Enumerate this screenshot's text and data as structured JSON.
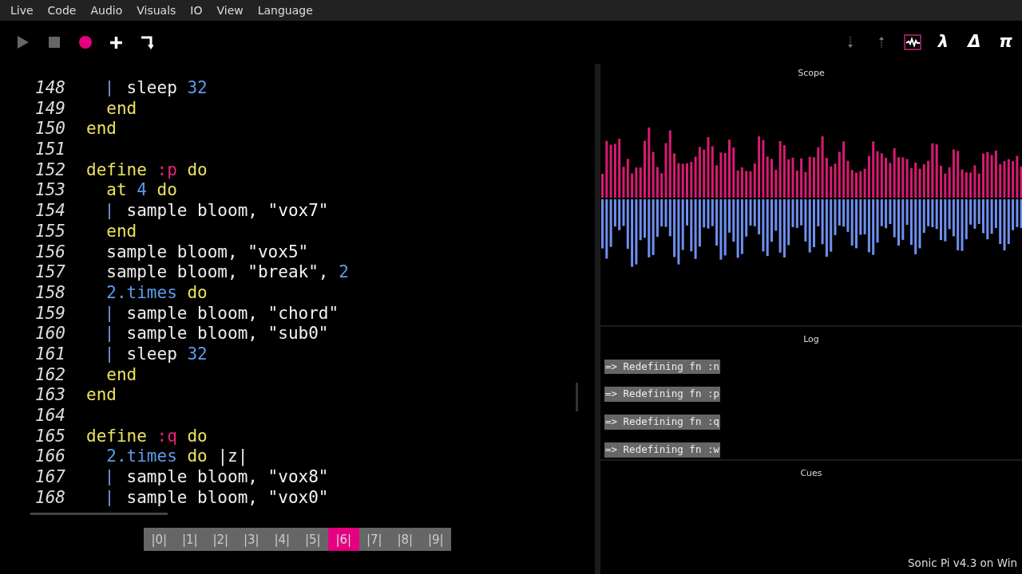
{
  "menu": [
    "Live",
    "Code",
    "Audio",
    "Visuals",
    "IO",
    "View",
    "Language"
  ],
  "toolbar": {
    "record_on": true,
    "scope_selected": true,
    "glyph_buttons": [
      "λ",
      "Δ",
      "π"
    ]
  },
  "editor": {
    "lines": [
      {
        "number": "148",
        "guide": true,
        "tokens": [
          {
            "kind": "plain",
            "text": "    sleep "
          },
          {
            "kind": "number",
            "text": "32"
          }
        ]
      },
      {
        "number": "149",
        "guide": false,
        "tokens": [
          {
            "kind": "keyword",
            "text": "  end"
          }
        ]
      },
      {
        "number": "150",
        "guide": false,
        "tokens": [
          {
            "kind": "keyword",
            "text": "end"
          }
        ]
      },
      {
        "number": "151",
        "guide": false
      },
      {
        "number": "152",
        "guide": false,
        "tokens": [
          {
            "kind": "keyword",
            "text": "define "
          },
          {
            "kind": "symbol",
            "text": ":p"
          },
          {
            "kind": "keyword",
            "text": " do"
          }
        ]
      },
      {
        "number": "153",
        "guide": false,
        "tokens": [
          {
            "kind": "keyword",
            "text": "  at "
          },
          {
            "kind": "number",
            "text": "4"
          },
          {
            "kind": "keyword",
            "text": " do"
          }
        ]
      },
      {
        "number": "154",
        "guide": true,
        "tokens": [
          {
            "kind": "plain",
            "text": "    sample bloom, "
          },
          {
            "kind": "string",
            "text": "\"vox7\""
          }
        ]
      },
      {
        "number": "155",
        "guide": false,
        "tokens": [
          {
            "kind": "keyword",
            "text": "  end"
          }
        ]
      },
      {
        "number": "156",
        "guide": false,
        "tokens": [
          {
            "kind": "plain",
            "text": "  sample bloom, "
          },
          {
            "kind": "string",
            "text": "\"vox5\""
          }
        ]
      },
      {
        "number": "157",
        "guide": false,
        "tokens": [
          {
            "kind": "plain",
            "text": "  sample bloom, "
          },
          {
            "kind": "string",
            "text": "\"break\""
          },
          {
            "kind": "plain",
            "text": ", "
          },
          {
            "kind": "number",
            "text": "2"
          }
        ]
      },
      {
        "number": "158",
        "guide": false,
        "tokens": [
          {
            "kind": "number",
            "text": "  2.times"
          },
          {
            "kind": "keyword",
            "text": " do"
          }
        ]
      },
      {
        "number": "159",
        "guide": true,
        "tokens": [
          {
            "kind": "plain",
            "text": "    sample bloom, "
          },
          {
            "kind": "string",
            "text": "\"chord\""
          }
        ]
      },
      {
        "number": "160",
        "guide": true,
        "tokens": [
          {
            "kind": "plain",
            "text": "    sample bloom, "
          },
          {
            "kind": "string",
            "text": "\"sub0\""
          }
        ]
      },
      {
        "number": "161",
        "guide": true,
        "tokens": [
          {
            "kind": "plain",
            "text": "    sleep "
          },
          {
            "kind": "number",
            "text": "32"
          }
        ]
      },
      {
        "number": "162",
        "guide": false,
        "tokens": [
          {
            "kind": "keyword",
            "text": "  end"
          }
        ]
      },
      {
        "number": "163",
        "guide": false,
        "tokens": [
          {
            "kind": "keyword",
            "text": "end"
          }
        ]
      },
      {
        "number": "164",
        "guide": false
      },
      {
        "number": "165",
        "guide": false,
        "tokens": [
          {
            "kind": "keyword",
            "text": "define "
          },
          {
            "kind": "symbol",
            "text": ":q"
          },
          {
            "kind": "keyword",
            "text": " do"
          }
        ]
      },
      {
        "number": "166",
        "guide": false,
        "tokens": [
          {
            "kind": "number",
            "text": "  2.times"
          },
          {
            "kind": "keyword",
            "text": " do "
          },
          {
            "kind": "plain",
            "text": "|z|"
          }
        ]
      },
      {
        "number": "167",
        "guide": true,
        "tokens": [
          {
            "kind": "plain",
            "text": "    sample bloom, "
          },
          {
            "kind": "string",
            "text": "\"vox8\""
          }
        ]
      },
      {
        "number": "168",
        "guide": true,
        "tokens": [
          {
            "kind": "plain",
            "text": "    sample bloom, "
          },
          {
            "kind": "string",
            "text": "\"vox0\""
          }
        ]
      }
    ]
  },
  "buffers": [
    {
      "label": "|0|",
      "selected": false
    },
    {
      "label": "|1|",
      "selected": false
    },
    {
      "label": "|2|",
      "selected": false
    },
    {
      "label": "|3|",
      "selected": false
    },
    {
      "label": "|4|",
      "selected": false
    },
    {
      "label": "|5|",
      "selected": false
    },
    {
      "label": "|6|",
      "selected": true
    },
    {
      "label": "|7|",
      "selected": false
    },
    {
      "label": "|8|",
      "selected": false
    },
    {
      "label": "|9|",
      "selected": false
    }
  ],
  "scope": {
    "title": "Scope"
  },
  "log": {
    "title": "Log",
    "entries": [
      "=> Redefining fn :n",
      "=> Redefining fn :p",
      "=> Redefining fn :q",
      "=> Redefining fn :w"
    ]
  },
  "cues": {
    "title": "Cues"
  },
  "status_bar": "Sonic Pi v4.3 on Win"
}
